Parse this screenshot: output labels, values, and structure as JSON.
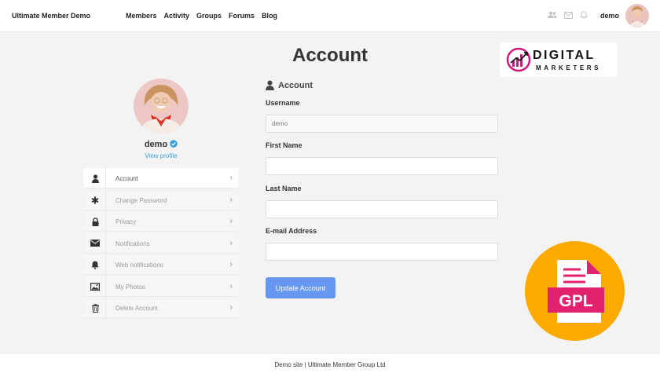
{
  "header": {
    "site_title": "Ultimate Member Demo",
    "nav": [
      "Members",
      "Activity",
      "Groups",
      "Forums",
      "Blog"
    ],
    "icons": [
      "friends-icon",
      "messages-icon",
      "notifications-icon"
    ],
    "username": "demo"
  },
  "page": {
    "title": "Account"
  },
  "brand_logo": {
    "word1": "DIGITAL",
    "word2": "MARKETERS",
    "accent_color": "#d0187a"
  },
  "profile": {
    "name": "demo",
    "view_profile": "View profile"
  },
  "account_menu": [
    {
      "label": "Account",
      "icon": "user-icon",
      "active": true
    },
    {
      "label": "Change Password",
      "icon": "asterisk-icon",
      "active": false
    },
    {
      "label": "Privacy",
      "icon": "lock-icon",
      "active": false
    },
    {
      "label": "Notifications",
      "icon": "envelope-icon",
      "active": false
    },
    {
      "label": "Web notifications",
      "icon": "bell-icon",
      "active": false
    },
    {
      "label": "My Photos",
      "icon": "image-icon",
      "active": false
    },
    {
      "label": "Delete Account",
      "icon": "trash-icon",
      "active": false
    }
  ],
  "form": {
    "section_title": "Account",
    "username_label": "Username",
    "username_value": "demo",
    "first_name_label": "First Name",
    "first_name_value": "",
    "last_name_label": "Last Name",
    "last_name_value": "",
    "email_label": "E-mail Address",
    "email_value": "",
    "submit_label": "Update Account"
  },
  "gpl_badge": {
    "text": "GPL",
    "circle_color": "#fbaa00",
    "doc_color": "#e2226f"
  },
  "footer": {
    "text": "Demo site | Ultimate Member Group Ltd"
  },
  "colors": {
    "primary_button": "#6698f2",
    "link": "#3ba1da",
    "verified": "#3ba1da"
  }
}
